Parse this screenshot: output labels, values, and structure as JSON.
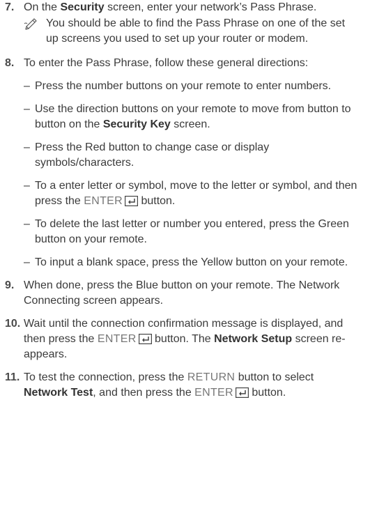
{
  "steps": [
    {
      "num": "7.",
      "parts": [
        "On the ",
        "Security",
        " screen, enter your network’s Pass Phrase."
      ],
      "note": "You should be able to find the Pass Phrase on one of the set up screens you used to set up your router or modem."
    },
    {
      "num": "8.",
      "intro": "To enter the Pass Phrase, follow these general directions:",
      "bullets": [
        {
          "dash": "–",
          "text": "Press the number buttons on your remote to enter numbers."
        },
        {
          "dash": "–",
          "pre": "Use the direction buttons on your remote to move from button to button on the ",
          "bold": "Security Key",
          "post": " screen."
        },
        {
          "dash": "–",
          "text": "Press the Red button to change case or display symbols/characters."
        },
        {
          "dash": "–",
          "pre": "To a enter letter or symbol, move to the letter or symbol, and then press the ",
          "btn": "ENTER",
          "post": " button."
        },
        {
          "dash": "–",
          "text": "To delete the last letter or number you entered, press the Green button on your remote."
        },
        {
          "dash": "–",
          "text": "To input a blank space, press the Yellow button on your remote."
        }
      ]
    },
    {
      "num": "9.",
      "text": "When done, press the Blue button on your remote. The Network Connecting screen appears."
    },
    {
      "num": "10.",
      "pre": "Wait until the connection confirmation message is displayed, and then press the ",
      "btn": "ENTER",
      "mid": " button. The ",
      "bold": "Network Setup",
      "post": " screen re-appears."
    },
    {
      "num": "11.",
      "pre": "To test the connection, press the ",
      "btn1": "RETURN",
      "mid1": " button to select ",
      "bold": "Network Test",
      "mid2": ", and then press the ",
      "btn2": "ENTER",
      "post": " button."
    }
  ],
  "icons": {
    "note": "pencil-note-icon",
    "enter": "enter-key-icon"
  }
}
